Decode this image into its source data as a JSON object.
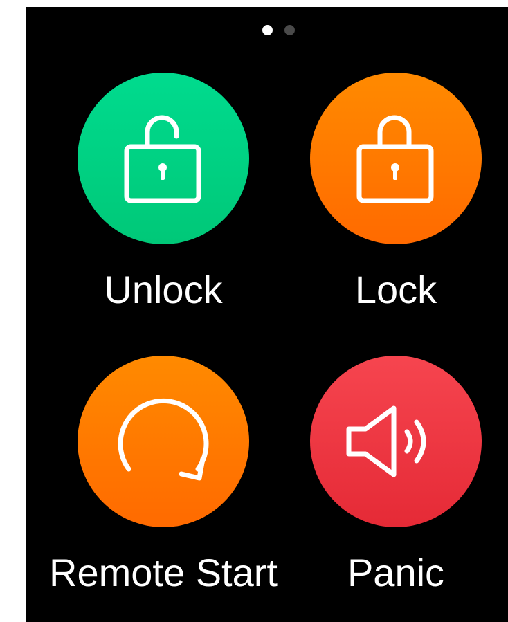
{
  "pager": {
    "pages": 2,
    "current": 1
  },
  "actions": [
    {
      "id": "unlock",
      "label": "Unlock",
      "icon": "unlock-icon",
      "color_top": "#00DB8E",
      "color_bottom": "#00C878"
    },
    {
      "id": "lock",
      "label": "Lock",
      "icon": "lock-icon",
      "color_top": "#FF8A00",
      "color_bottom": "#FF6A00"
    },
    {
      "id": "remote_start",
      "label": "Remote Start",
      "icon": "restart-icon",
      "color_top": "#FF8A00",
      "color_bottom": "#FF6A00"
    },
    {
      "id": "panic",
      "label": "Panic",
      "icon": "speaker-icon",
      "color_top": "#F6454F",
      "color_bottom": "#E52A36"
    }
  ]
}
